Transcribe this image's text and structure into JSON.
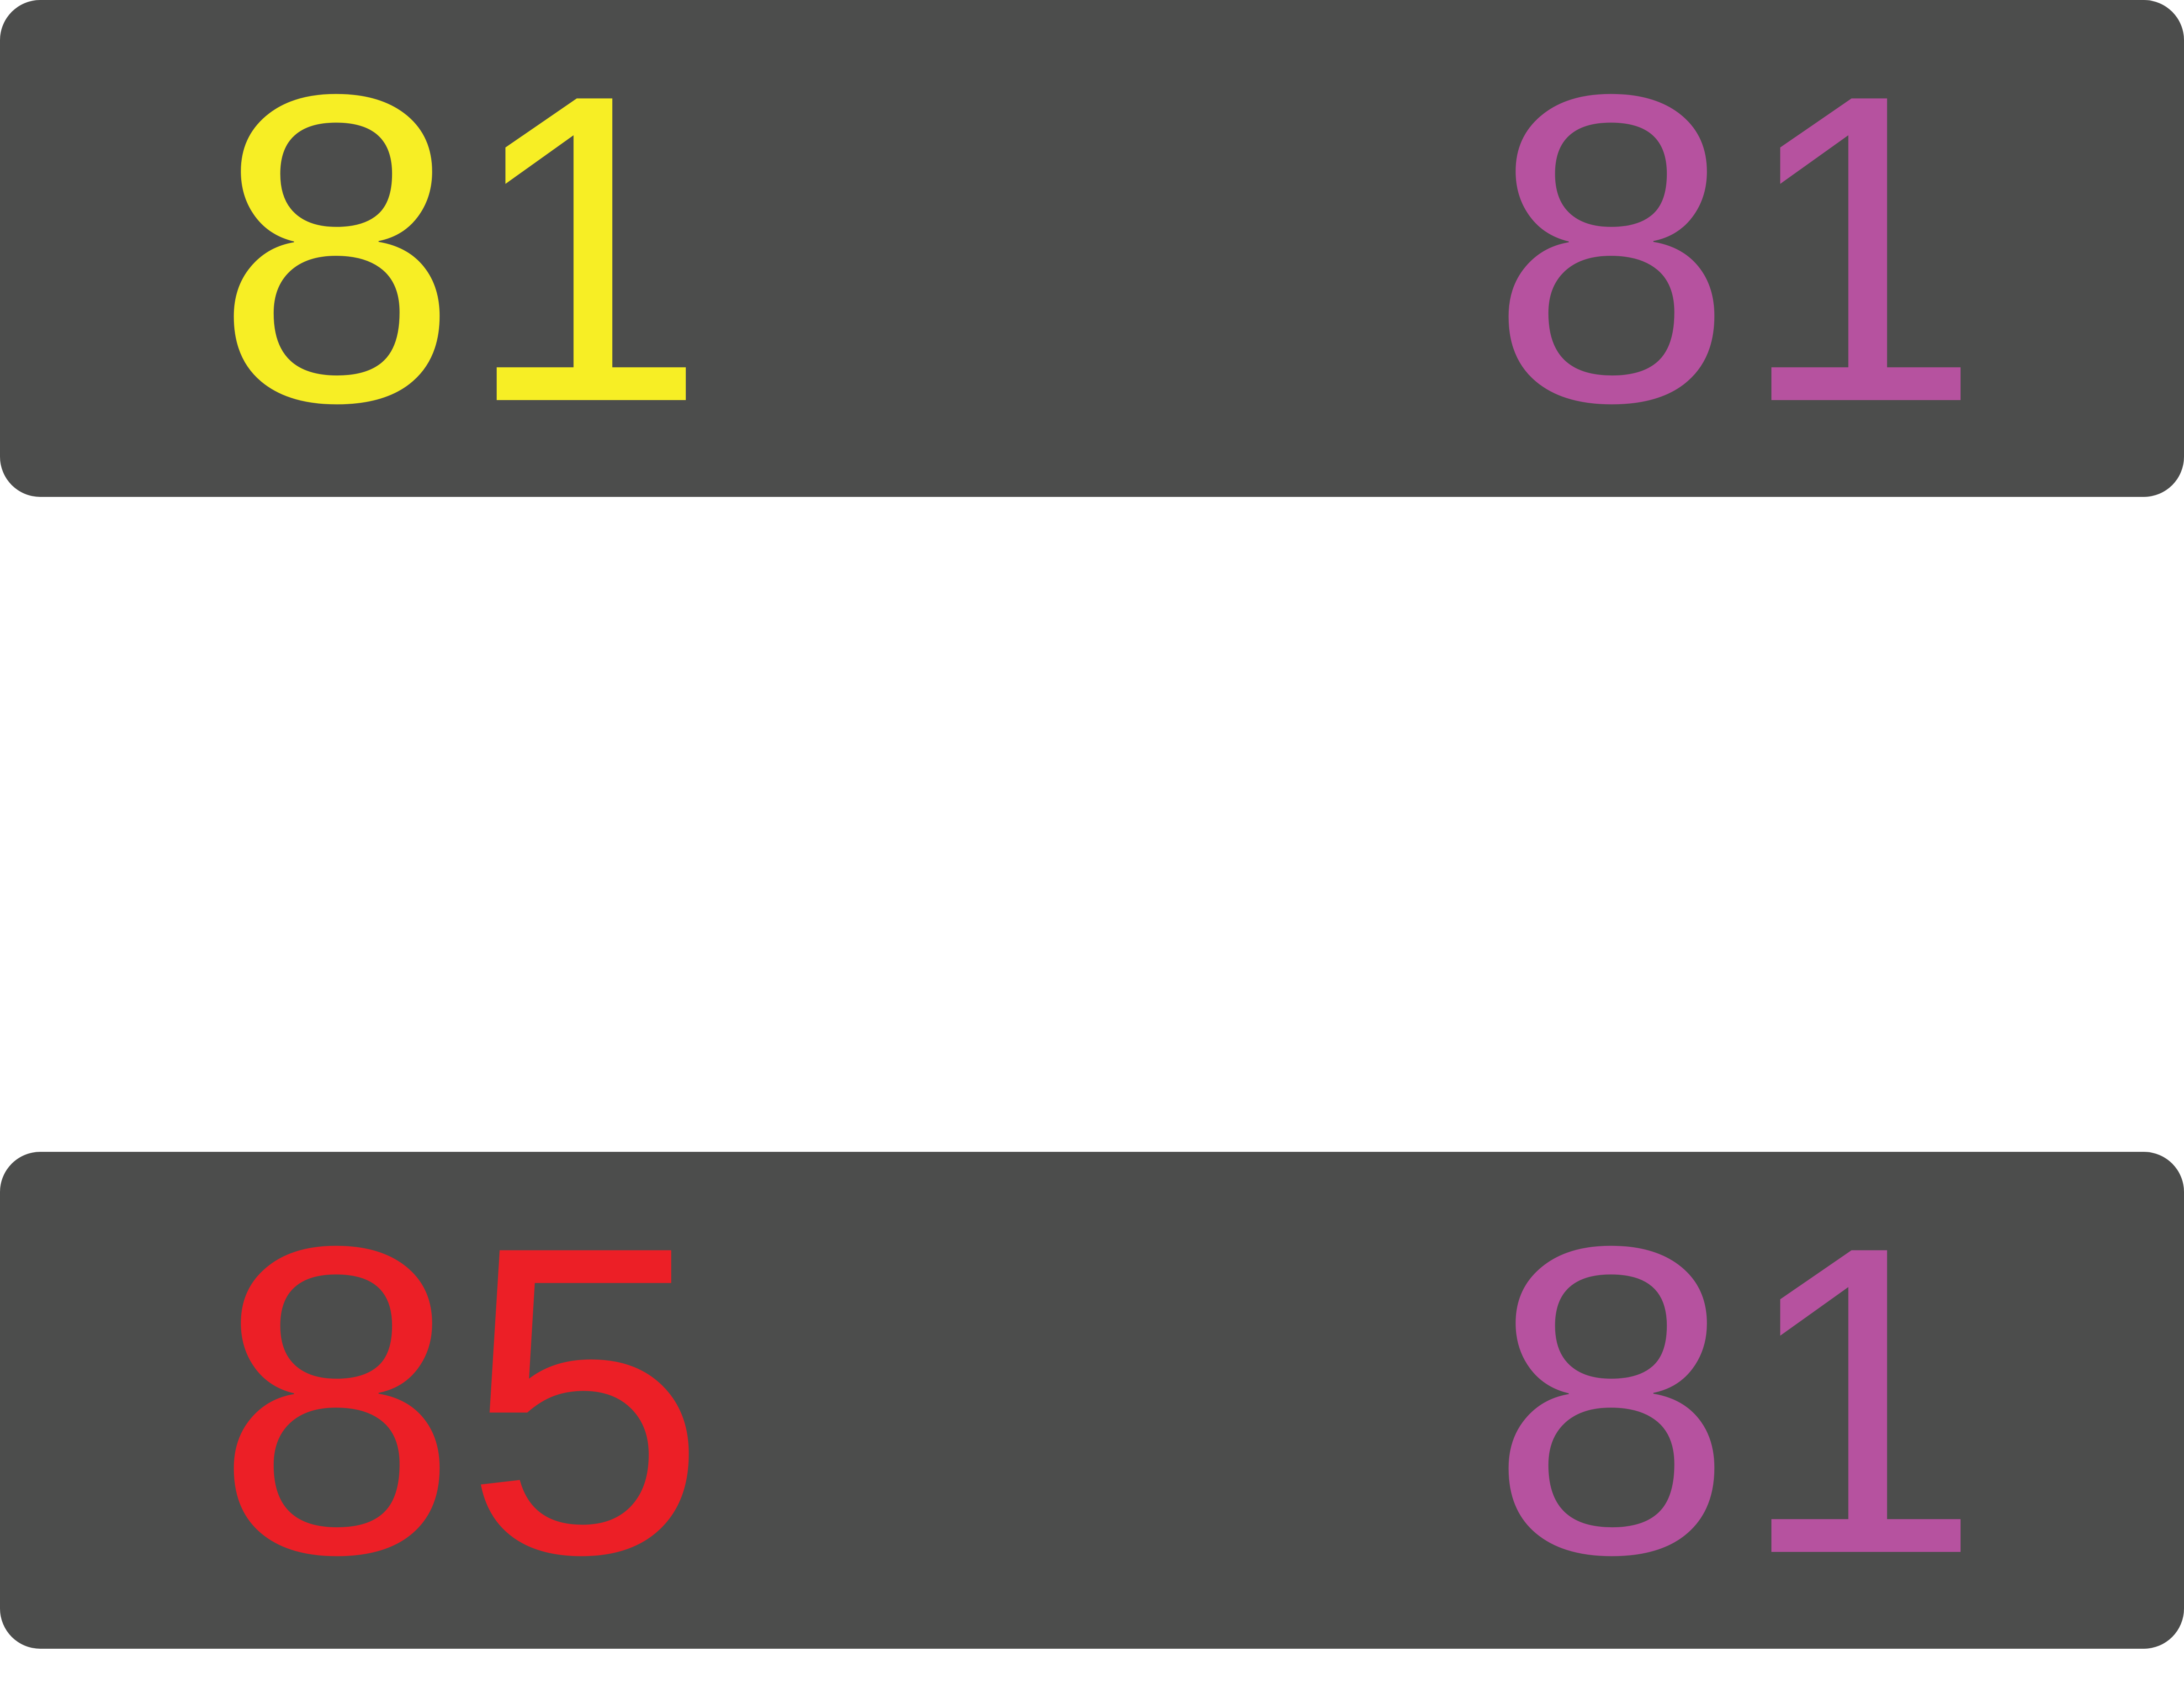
{
  "panels": [
    {
      "left": {
        "value": "81",
        "color": "#f7ee25"
      },
      "right": {
        "value": "81",
        "color": "#b6529f"
      }
    },
    {
      "left": {
        "value": "85",
        "color": "#ec1f26"
      },
      "right": {
        "value": "81",
        "color": "#b6529f"
      }
    }
  ]
}
